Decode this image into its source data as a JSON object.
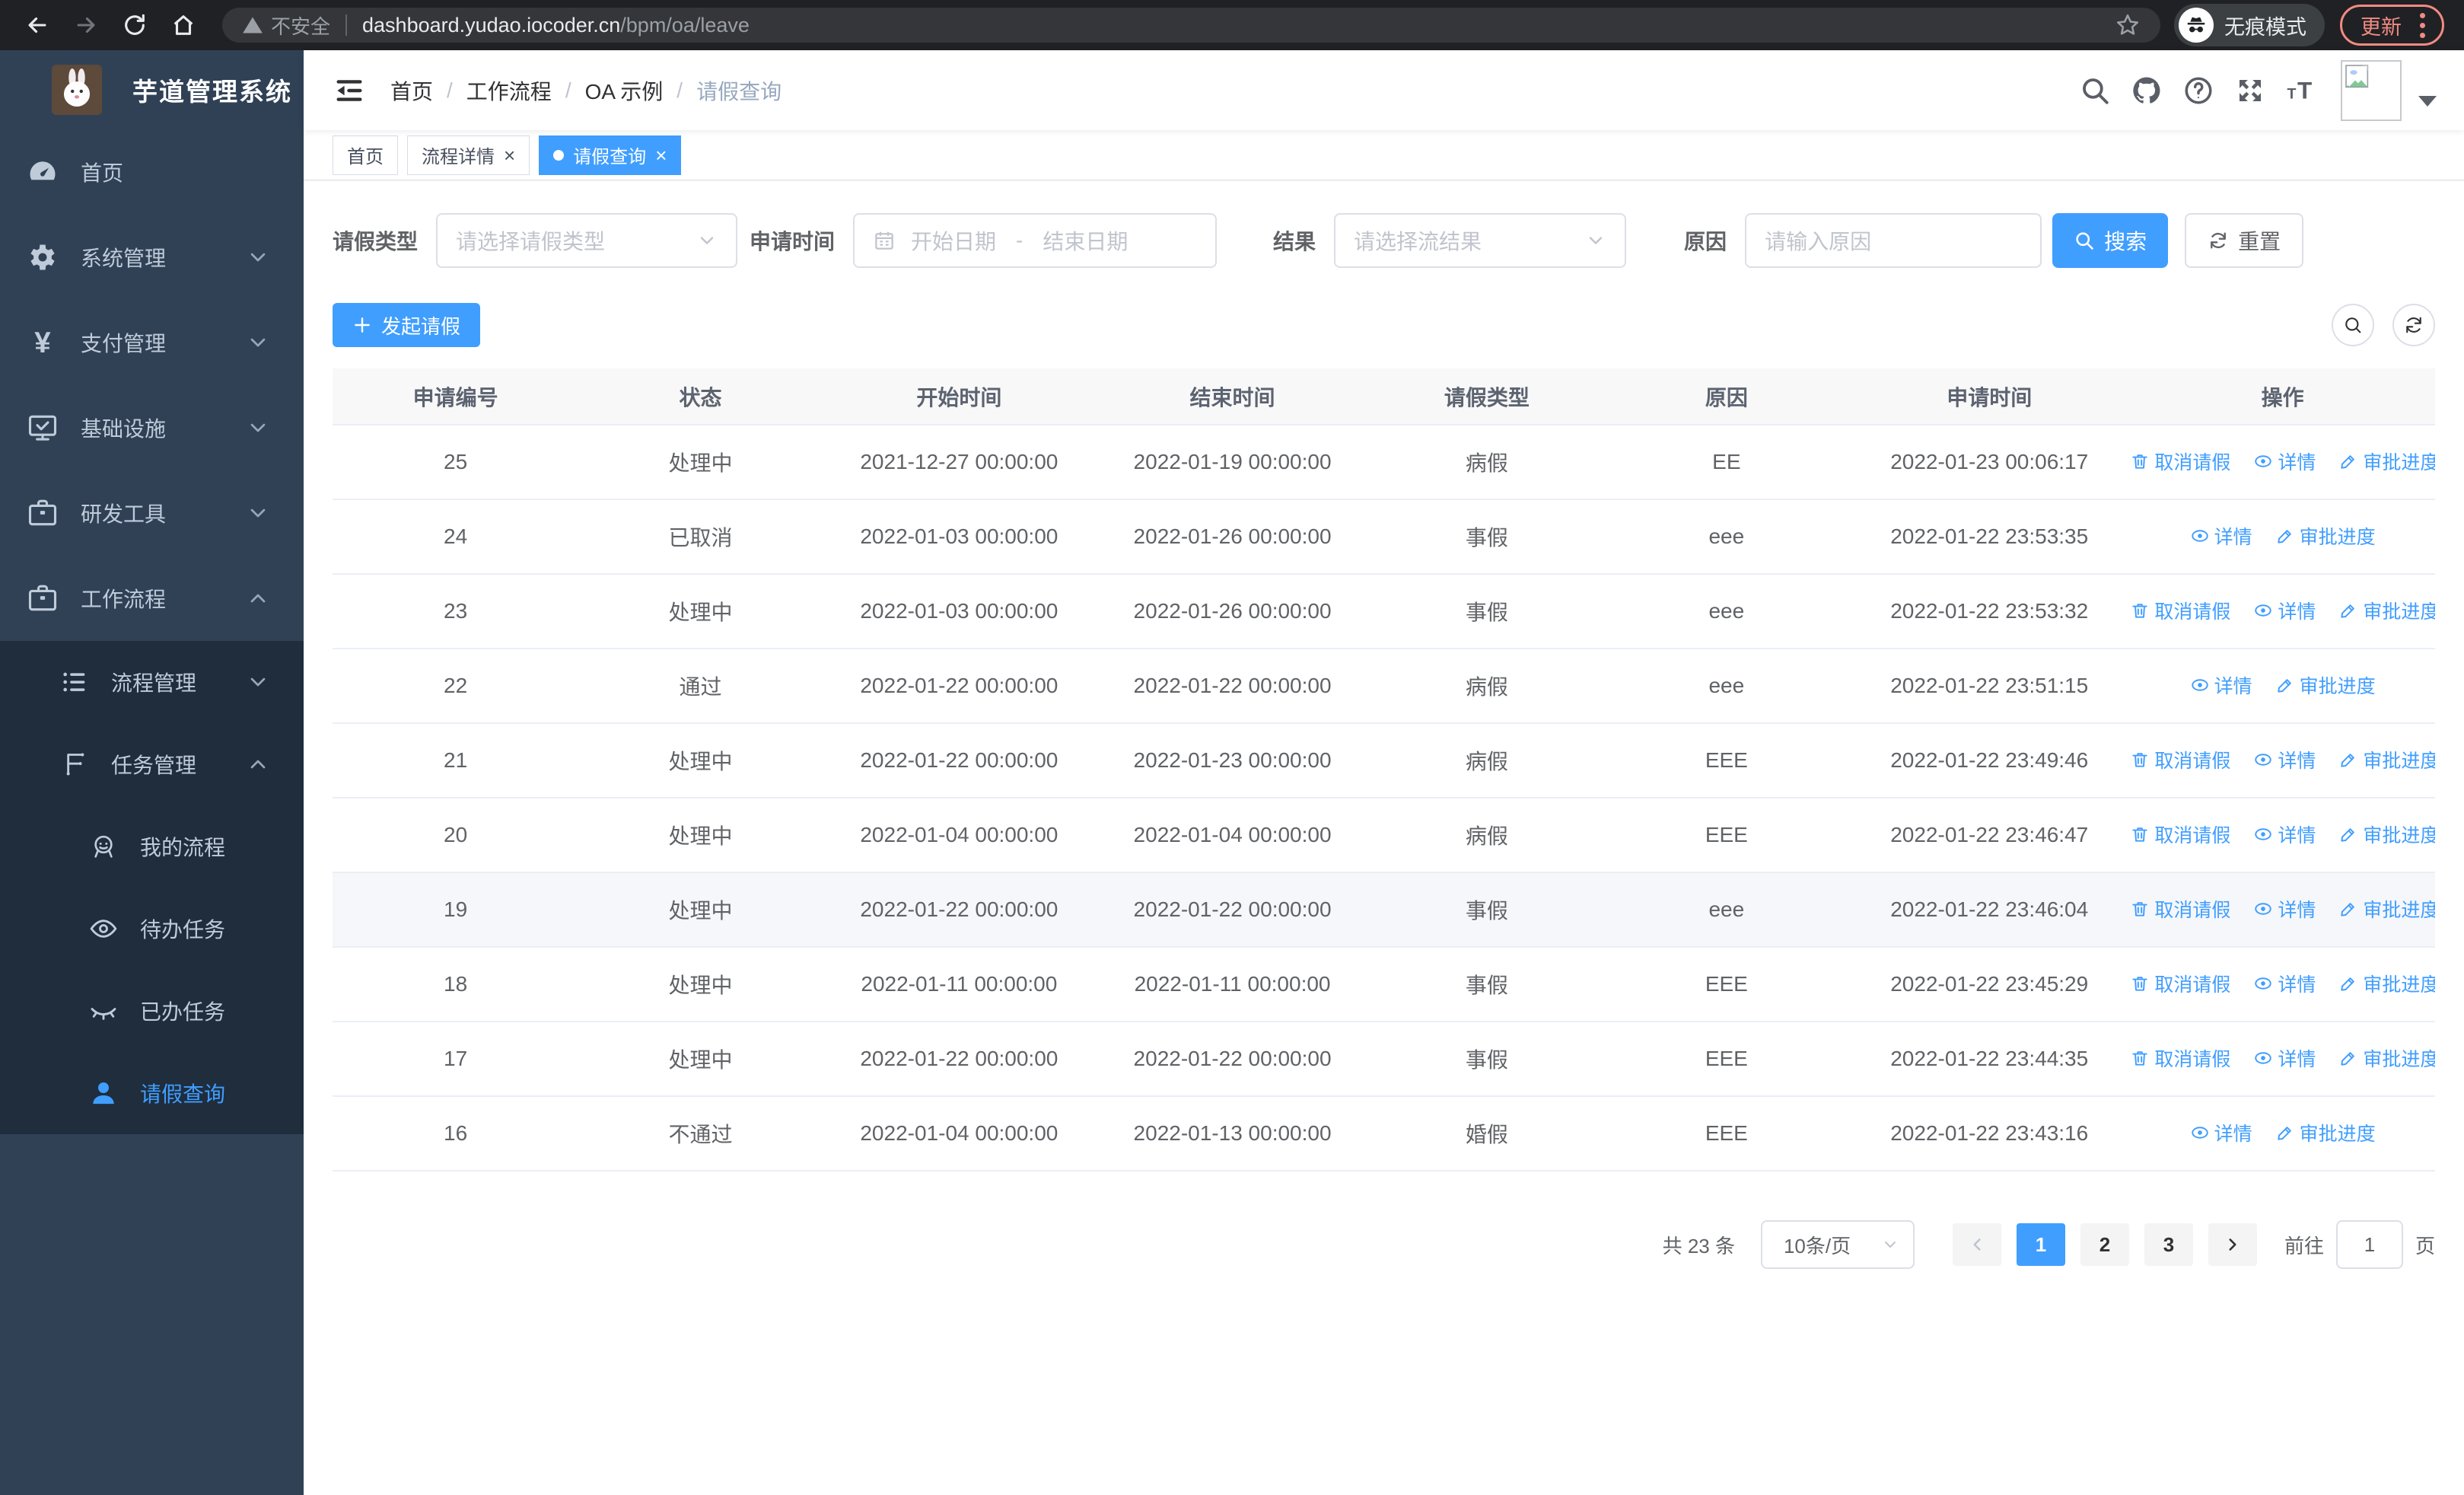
{
  "browser": {
    "security_label": "不安全",
    "url_host": "dashboard.yudao.iocoder.cn",
    "url_path": "/bpm/oa/leave",
    "incognito_label": "无痕模式",
    "update_label": "更新"
  },
  "sidebar": {
    "app_title": "芋道管理系统",
    "items": [
      {
        "name": "home",
        "label": "首页",
        "icon": "dashboard-icon",
        "type": "top",
        "arrow": null,
        "active": false
      },
      {
        "name": "system-management",
        "label": "系统管理",
        "icon": "gear-icon",
        "type": "top",
        "arrow": "down",
        "active": false
      },
      {
        "name": "payment-management",
        "label": "支付管理",
        "icon": "yen-icon",
        "type": "top",
        "arrow": "down",
        "active": false
      },
      {
        "name": "infrastructure",
        "label": "基础设施",
        "icon": "monitor-icon",
        "type": "top",
        "arrow": "down",
        "active": false
      },
      {
        "name": "dev-tools",
        "label": "研发工具",
        "icon": "briefcase-icon",
        "type": "top",
        "arrow": "down",
        "active": false
      },
      {
        "name": "workflow",
        "label": "工作流程",
        "icon": "briefcase-icon",
        "type": "top",
        "arrow": "up",
        "active": false
      },
      {
        "name": "process-management",
        "label": "流程管理",
        "icon": "list-icon",
        "type": "sub1",
        "arrow": "down",
        "active": false
      },
      {
        "name": "task-management",
        "label": "任务管理",
        "icon": "flow-icon",
        "type": "sub1",
        "arrow": "up",
        "active": false
      },
      {
        "name": "my-processes",
        "label": "我的流程",
        "icon": "face-icon",
        "type": "sub2",
        "arrow": null,
        "active": false
      },
      {
        "name": "todo-tasks",
        "label": "待办任务",
        "icon": "eye-open-icon",
        "type": "sub2",
        "arrow": null,
        "active": false
      },
      {
        "name": "done-tasks",
        "label": "已办任务",
        "icon": "eye-closed-icon",
        "type": "sub2",
        "arrow": null,
        "active": false
      },
      {
        "name": "leave-query",
        "label": "请假查询",
        "icon": "user-icon",
        "type": "sub2",
        "arrow": null,
        "active": true
      }
    ]
  },
  "header": {
    "breadcrumb": [
      "首页",
      "工作流程",
      "OA 示例",
      "请假查询"
    ]
  },
  "tabs": [
    {
      "name": "home",
      "label": "首页",
      "active": false,
      "closable": false
    },
    {
      "name": "process-detail",
      "label": "流程详情",
      "active": false,
      "closable": true
    },
    {
      "name": "leave-query",
      "label": "请假查询",
      "active": true,
      "closable": true
    }
  ],
  "filters": {
    "leave_type_label": "请假类型",
    "leave_type_placeholder": "请选择请假类型",
    "apply_time_label": "申请时间",
    "start_date_placeholder": "开始日期",
    "range_separator": "-",
    "end_date_placeholder": "结束日期",
    "result_label": "结果",
    "result_placeholder": "请选择流结果",
    "reason_label": "原因",
    "reason_placeholder": "请输入原因",
    "search_label": "搜索",
    "reset_label": "重置"
  },
  "toolbar": {
    "create_label": "发起请假"
  },
  "table": {
    "columns": [
      "申请编号",
      "状态",
      "开始时间",
      "结束时间",
      "请假类型",
      "原因",
      "申请时间",
      "操作"
    ],
    "action_labels": {
      "cancel": "取消请假",
      "detail": "详情",
      "progress": "审批进度"
    },
    "rows": [
      {
        "id": "25",
        "status": "处理中",
        "start": "2021-12-27 00:00:00",
        "end": "2022-01-19 00:00:00",
        "type": "病假",
        "reason": "EE",
        "applied": "2022-01-23 00:06:17",
        "actions": [
          "cancel",
          "detail",
          "progress"
        ],
        "highlight": false
      },
      {
        "id": "24",
        "status": "已取消",
        "start": "2022-01-03 00:00:00",
        "end": "2022-01-26 00:00:00",
        "type": "事假",
        "reason": "eee",
        "applied": "2022-01-22 23:53:35",
        "actions": [
          "detail",
          "progress"
        ],
        "highlight": false
      },
      {
        "id": "23",
        "status": "处理中",
        "start": "2022-01-03 00:00:00",
        "end": "2022-01-26 00:00:00",
        "type": "事假",
        "reason": "eee",
        "applied": "2022-01-22 23:53:32",
        "actions": [
          "cancel",
          "detail",
          "progress"
        ],
        "highlight": false
      },
      {
        "id": "22",
        "status": "通过",
        "start": "2022-01-22 00:00:00",
        "end": "2022-01-22 00:00:00",
        "type": "病假",
        "reason": "eee",
        "applied": "2022-01-22 23:51:15",
        "actions": [
          "detail",
          "progress"
        ],
        "highlight": false
      },
      {
        "id": "21",
        "status": "处理中",
        "start": "2022-01-22 00:00:00",
        "end": "2022-01-23 00:00:00",
        "type": "病假",
        "reason": "EEE",
        "applied": "2022-01-22 23:49:46",
        "actions": [
          "cancel",
          "detail",
          "progress"
        ],
        "highlight": false
      },
      {
        "id": "20",
        "status": "处理中",
        "start": "2022-01-04 00:00:00",
        "end": "2022-01-04 00:00:00",
        "type": "病假",
        "reason": "EEE",
        "applied": "2022-01-22 23:46:47",
        "actions": [
          "cancel",
          "detail",
          "progress"
        ],
        "highlight": false
      },
      {
        "id": "19",
        "status": "处理中",
        "start": "2022-01-22 00:00:00",
        "end": "2022-01-22 00:00:00",
        "type": "事假",
        "reason": "eee",
        "applied": "2022-01-22 23:46:04",
        "actions": [
          "cancel",
          "detail",
          "progress"
        ],
        "highlight": true
      },
      {
        "id": "18",
        "status": "处理中",
        "start": "2022-01-11 00:00:00",
        "end": "2022-01-11 00:00:00",
        "type": "事假",
        "reason": "EEE",
        "applied": "2022-01-22 23:45:29",
        "actions": [
          "cancel",
          "detail",
          "progress"
        ],
        "highlight": false
      },
      {
        "id": "17",
        "status": "处理中",
        "start": "2022-01-22 00:00:00",
        "end": "2022-01-22 00:00:00",
        "type": "事假",
        "reason": "EEE",
        "applied": "2022-01-22 23:44:35",
        "actions": [
          "cancel",
          "detail",
          "progress"
        ],
        "highlight": false
      },
      {
        "id": "16",
        "status": "不通过",
        "start": "2022-01-04 00:00:00",
        "end": "2022-01-13 00:00:00",
        "type": "婚假",
        "reason": "EEE",
        "applied": "2022-01-22 23:43:16",
        "actions": [
          "detail",
          "progress"
        ],
        "highlight": false
      }
    ]
  },
  "pagination": {
    "total_label": "共 23 条",
    "page_size": "10条/页",
    "pages": [
      "1",
      "2",
      "3"
    ],
    "active_page": "1",
    "goto_label": "前往",
    "goto_value": "1",
    "page_unit": "页"
  },
  "colors": {
    "accent": "#409eff",
    "sidebar_bg": "#304156",
    "submenu_bg": "#1f2d3d",
    "chrome_bar_bg": "#202124",
    "update_accent": "#f28b82",
    "table_header_bg": "#f8f8f9",
    "link": "#409eff"
  }
}
